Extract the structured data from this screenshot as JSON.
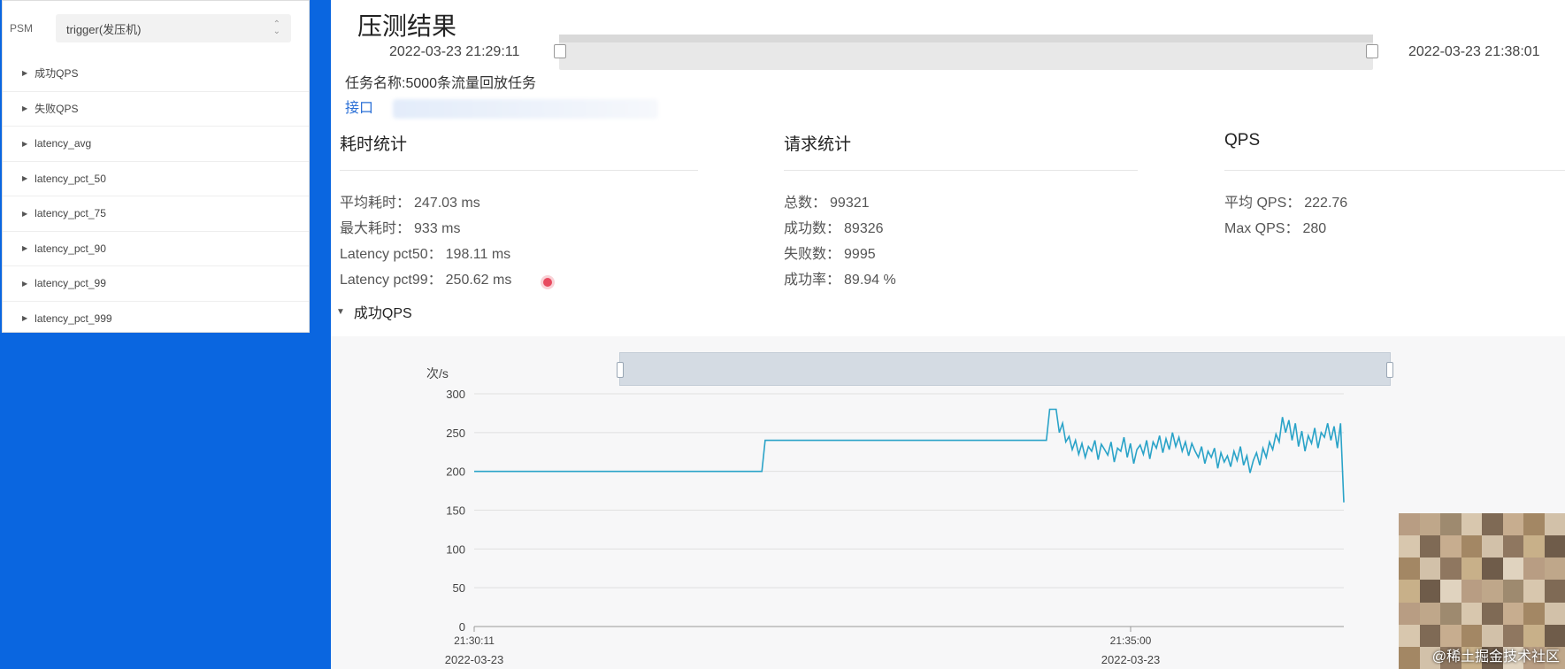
{
  "sidebar": {
    "psm_label": "PSM",
    "psm_value": "trigger(发压机)",
    "metrics": [
      "成功QPS",
      "失败QPS",
      "latency_avg",
      "latency_pct_50",
      "latency_pct_75",
      "latency_pct_90",
      "latency_pct_99",
      "latency_pct_999"
    ]
  },
  "main": {
    "title": "压测结果",
    "time_start": "2022-03-23 21:29:11",
    "time_end": "2022-03-23 21:38:01",
    "task_name": "任务名称:5000条流量回放任务",
    "interface_label": "接口",
    "latency": {
      "heading": "耗时统计",
      "rows": [
        {
          "label": "平均耗时：",
          "value": "247.03 ms"
        },
        {
          "label": "最大耗时：",
          "value": "933 ms"
        },
        {
          "label": "Latency pct50：",
          "value": "198.11 ms"
        },
        {
          "label": "Latency pct99：",
          "value": "250.62 ms"
        }
      ]
    },
    "requests": {
      "heading": "请求统计",
      "rows": [
        {
          "label": "总数：",
          "value": "99321"
        },
        {
          "label": "成功数：",
          "value": "89326"
        },
        {
          "label": "失败数：",
          "value": "9995"
        },
        {
          "label": "成功率：",
          "value": "89.94 %"
        }
      ]
    },
    "qps": {
      "heading": "QPS",
      "rows": [
        {
          "label": "平均 QPS：",
          "value": "222.76"
        },
        {
          "label": "Max QPS：",
          "value": "280"
        }
      ]
    },
    "section_label": "成功QPS",
    "watermark_text": "@稀土掘金技术社区"
  },
  "chart_data": {
    "type": "line",
    "ylabel": "次/s",
    "ylim": [
      0,
      300
    ],
    "yticks": [
      0,
      50,
      100,
      150,
      200,
      250,
      300
    ],
    "xtick_labels": [
      {
        "time": "21:30:11",
        "date": "2022-03-23"
      },
      {
        "time": "21:35:00",
        "date": "2022-03-23"
      }
    ],
    "color": "#2aa3c8",
    "series": [
      {
        "values": [
          200,
          200,
          200,
          200,
          200,
          200,
          200,
          200,
          200,
          200,
          200,
          200,
          200,
          200,
          200,
          200,
          200,
          200,
          200,
          200,
          200,
          200,
          200,
          200,
          200,
          200,
          200,
          200,
          200,
          200,
          200,
          200,
          200,
          200,
          200,
          200,
          200,
          200,
          200,
          200,
          200,
          200,
          200,
          200,
          200,
          200,
          200,
          200,
          200,
          200,
          200,
          200,
          200,
          200,
          200,
          200,
          200,
          200,
          200,
          200,
          200,
          200,
          200,
          200,
          200,
          200,
          200,
          200,
          200,
          200,
          200,
          200,
          200,
          200,
          200,
          200,
          200,
          200,
          200,
          200,
          200,
          200,
          200,
          200,
          200,
          200,
          200,
          200,
          200,
          200,
          240,
          240,
          240,
          240,
          240,
          240,
          240,
          240,
          240,
          240,
          240,
          240,
          240,
          240,
          240,
          240,
          240,
          240,
          240,
          240,
          240,
          240,
          240,
          240,
          240,
          240,
          240,
          240,
          240,
          240,
          240,
          240,
          240,
          240,
          240,
          240,
          240,
          240,
          240,
          240,
          240,
          240,
          240,
          240,
          240,
          240,
          240,
          240,
          240,
          240,
          240,
          240,
          240,
          240,
          240,
          240,
          240,
          240,
          240,
          240,
          240,
          240,
          240,
          240,
          240,
          240,
          240,
          240,
          240,
          240,
          240,
          240,
          240,
          240,
          240,
          240,
          240,
          240,
          240,
          240,
          240,
          240,
          240,
          240,
          240,
          240,
          240,
          240,
          280,
          280,
          280,
          250,
          262,
          238,
          245,
          228,
          240,
          222,
          236,
          218,
          232,
          226,
          240,
          215,
          235,
          228,
          221,
          238,
          212,
          230,
          226,
          244,
          218,
          236,
          210,
          228,
          234,
          222,
          240,
          216,
          238,
          230,
          246,
          224,
          242,
          228,
          250,
          232,
          244,
          226,
          238,
          220,
          236,
          226,
          218,
          232,
          210,
          226,
          218,
          230,
          204,
          224,
          212,
          220,
          206,
          226,
          214,
          232,
          208,
          220,
          198,
          214,
          224,
          208,
          230,
          218,
          238,
          228,
          248,
          238,
          270,
          250,
          266,
          240,
          262,
          232,
          252,
          226,
          246,
          236,
          256,
          230,
          250,
          244,
          262,
          240,
          258,
          230,
          262,
          160
        ]
      }
    ]
  }
}
